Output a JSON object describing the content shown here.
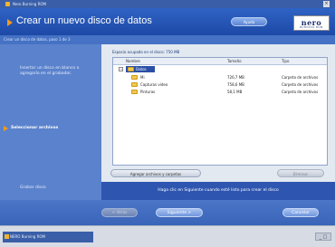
{
  "window": {
    "title": "Nero Burning ROM",
    "close_glyph": "×"
  },
  "header": {
    "title": "Crear un nuevo disco de datos",
    "help_label": "Ayuda",
    "logo_text": "nero",
    "logo_sub": "BURNING ROM"
  },
  "stepbar": {
    "text": "Crear un disco de datos, paso 1 de 3"
  },
  "sidebar": {
    "step1": "Insertar un disco en blanco o agregarlo en el grabador.",
    "step2": "Seleccionar archivos",
    "step3": "Grabar disco"
  },
  "content": {
    "space_label": "Espacio ocupado en el disco: 750 MB",
    "columns": {
      "name": "Nombre",
      "size": "Tamaño",
      "type": "Tipo"
    },
    "rows": [
      {
        "name": "Datos",
        "size": "",
        "type": ""
      },
      {
        "name": "Mi",
        "size": "726,7 MB",
        "type": "Carpeta de archivos"
      },
      {
        "name": "Capturas video",
        "size": "758,6 MB",
        "type": "Carpeta de archivos"
      },
      {
        "name": "Pinturas",
        "size": "58,1 MB",
        "type": "Carpeta de archivos"
      }
    ],
    "add_button": "Agregar archivos y carpetas",
    "delete_button": "Eliminar",
    "info_text": "Haga clic en Siguiente cuando esté listo para crear el disco"
  },
  "footer": {
    "back_label": "< Atrás",
    "next_label": "Siguiente >",
    "cancel_label": "Cancelar"
  },
  "taskbar": {
    "item_label": "NERO Burning ROM",
    "controls": "_ □"
  }
}
